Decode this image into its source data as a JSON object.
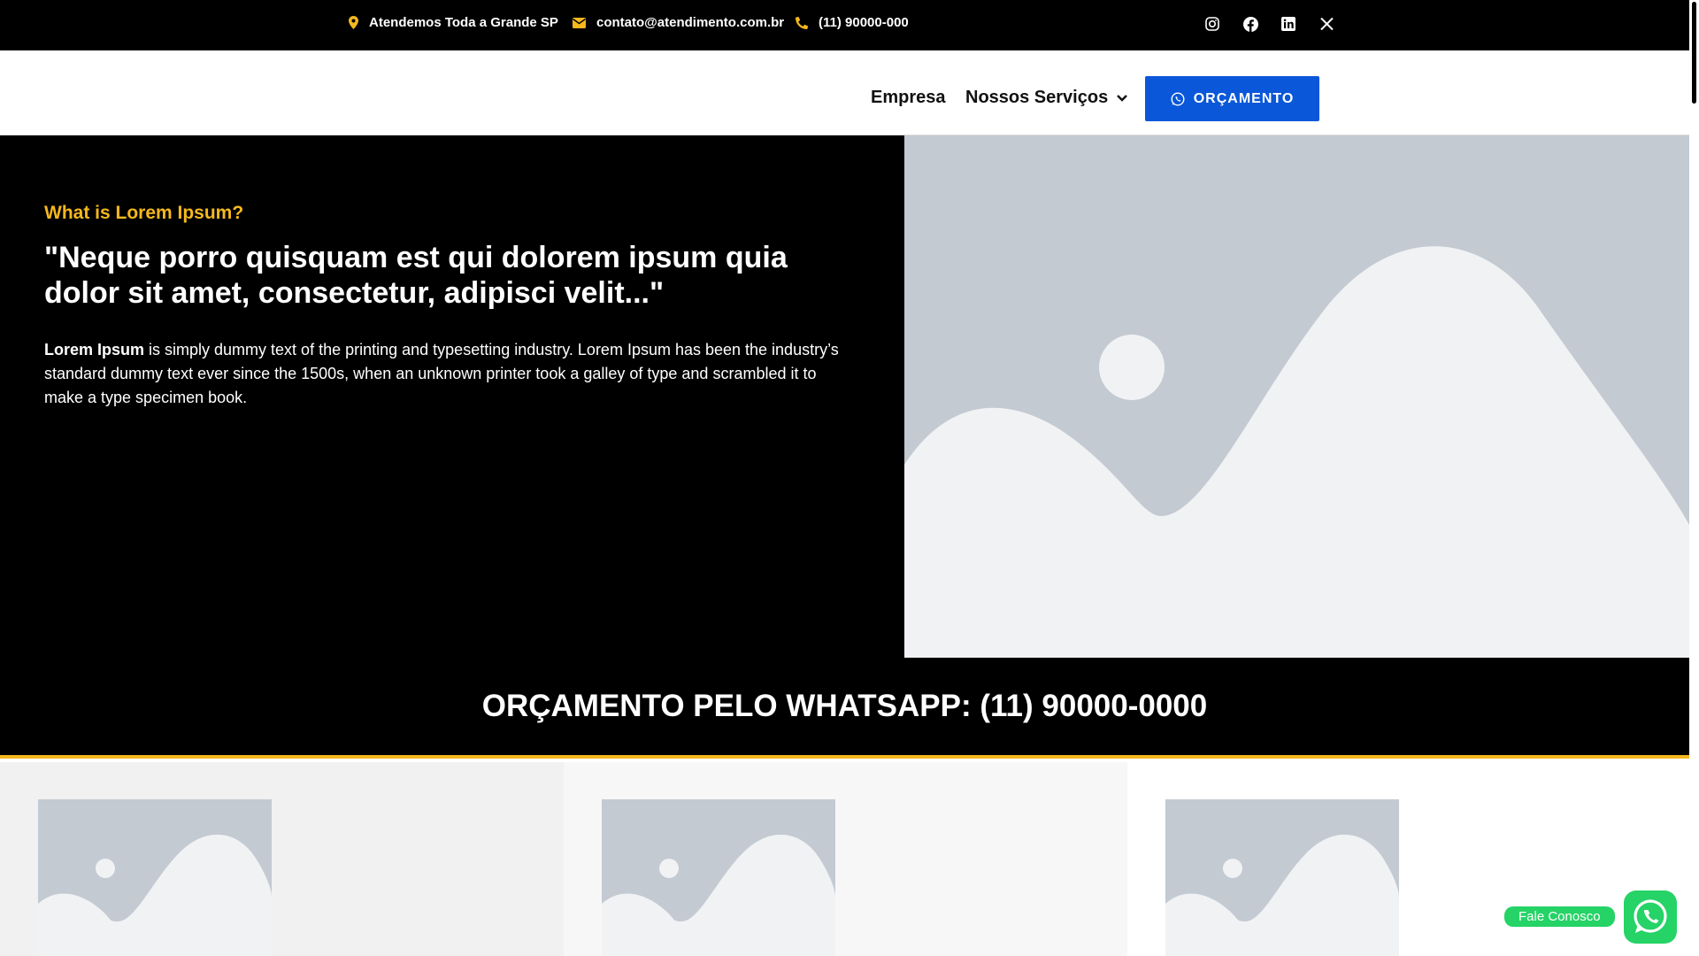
{
  "topbar": {
    "location": "Atendemos Toda a Grande SP",
    "email": "contato@atendimento.com.br",
    "phone": "(11) 90000-000",
    "social_icons": [
      "instagram-icon",
      "facebook-icon",
      "linkedin-icon",
      "x-icon"
    ]
  },
  "nav": {
    "links": [
      "Empresa",
      "Nossos Serviços"
    ],
    "cta_label": "ORÇAMENTO"
  },
  "hero": {
    "eyebrow": "What is Lorem Ipsum?",
    "headline": "\"Neque porro quisquam est qui dolorem ipsum quia dolor sit amet, consectetur, adipisci velit...\"",
    "body_bold": "Lorem Ipsum",
    "body_rest": " is simply dummy text of the printing and typesetting industry. Lorem Ipsum has been the industry’s standard dummy text ever since the 1500s, when an unknown printer took a galley of type and scrambled it to make a type specimen book."
  },
  "banner": {
    "text": "ORÇAMENTO PELO WHATSAPP: (11) 90000-0000"
  },
  "floating": {
    "label": "Fale Conosco"
  },
  "colors": {
    "accent_yellow": "#f5b81e",
    "cta_blue": "#0a57d9",
    "whatsapp_green": "#25d366",
    "placeholder_dark": "#c3cad2",
    "placeholder_light": "#f1f2f4"
  }
}
